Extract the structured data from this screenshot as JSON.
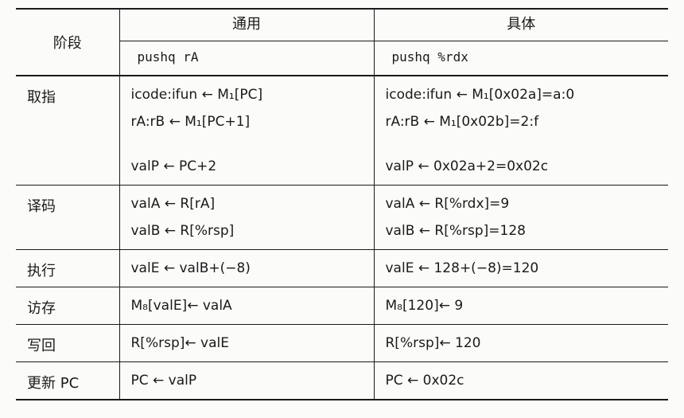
{
  "header": {
    "stage": "阶段",
    "general": "通用",
    "specific": "具体"
  },
  "instruction": {
    "general": "pushq rA",
    "specific": "pushq %rdx"
  },
  "rows": {
    "fetch": {
      "stage": "取指",
      "general": [
        "icode:ifun ← M₁[PC]",
        "rA:rB ← M₁[PC+1]",
        "valP ← PC+2"
      ],
      "specific": [
        "icode:ifun ← M₁[0x02a]=a:0",
        "rA:rB ← M₁[0x02b]=2:f",
        "valP ← 0x02a+2=0x02c"
      ]
    },
    "decode": {
      "stage": "译码",
      "general": [
        "valA ← R[rA]",
        "valB ← R[%rsp]"
      ],
      "specific": [
        "valA ← R[%rdx]=9",
        "valB ← R[%rsp]=128"
      ]
    },
    "execute": {
      "stage": "执行",
      "general": [
        "valE ← valB+(−8)"
      ],
      "specific": [
        "valE ← 128+(−8)=120"
      ]
    },
    "memory": {
      "stage": "访存",
      "general": [
        "M₈[valE]← valA"
      ],
      "specific": [
        "M₈[120]← 9"
      ]
    },
    "writeback": {
      "stage": "写回",
      "general": [
        "R[%rsp]← valE"
      ],
      "specific": [
        "R[%rsp]← 120"
      ]
    },
    "update_pc": {
      "stage": "更新 PC",
      "general": [
        "PC ← valP"
      ],
      "specific": [
        "PC ← 0x02c"
      ]
    }
  }
}
